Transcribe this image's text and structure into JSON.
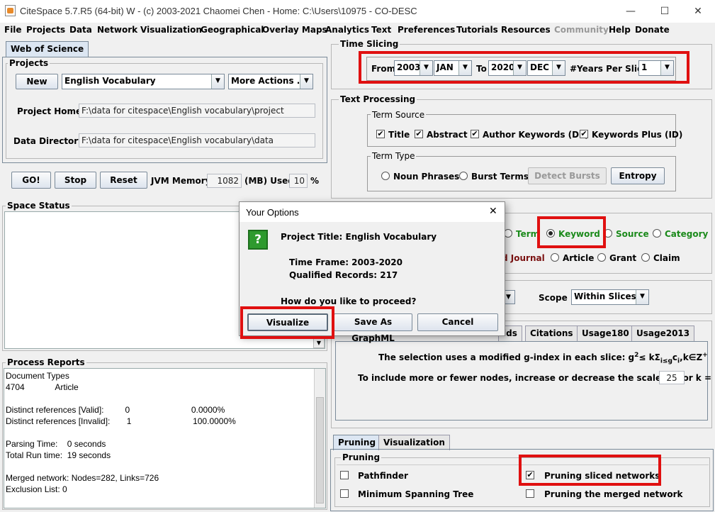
{
  "window": {
    "title": "CiteSpace 5.7.R5 (64-bit) W - (c) 2003-2021 Chaomei Chen - Home: C:\\Users\\10975 - CO-DESC",
    "minimize": "—",
    "maximize": "☐",
    "close": "✕"
  },
  "menu": [
    "File",
    "Projects",
    "Data",
    "Network",
    "Visualization",
    "Geographical",
    "Overlay Maps",
    "Analytics",
    "Text",
    "Preferences",
    "Tutorials",
    "Resources",
    "Community",
    "Help",
    "Donate"
  ],
  "left": {
    "tab": "Web of Science",
    "projects_label": "Projects",
    "new_btn": "New",
    "project_select": "English Vocabulary",
    "more_actions": "More Actions ...",
    "project_home_label": "Project Home:",
    "project_home": "F:\\data for citespace\\English vocabulary\\project",
    "data_dir_label": "Data Directory:",
    "data_dir": "F:\\data for citespace\\English vocabulary\\data",
    "go_btn": "GO!",
    "stop_btn": "Stop",
    "reset_btn": "Reset",
    "jvm_label": "JVM Memory",
    "jvm_value": "1082",
    "mb_used_label": "(MB) Used",
    "used_value": "10",
    "pct": "%",
    "space_status": "Space Status",
    "process_reports": "Process Reports",
    "report_lines": [
      "Document Types",
      "4704             Article",
      "",
      "Distinct references [Valid]:         0                          0.0000%",
      "Distinct references [Invalid]:       1                          100.0000%",
      "",
      "Parsing Time:    0 seconds",
      "Total Run time:  19 seconds",
      "",
      "Merged network: Nodes=282, Links=726",
      "Exclusion List: 0"
    ]
  },
  "time_slicing": {
    "label": "Time Slicing",
    "from": "From",
    "from_year": "2003",
    "from_month": "JAN",
    "to": "To",
    "to_year": "2020",
    "to_month": "DEC",
    "years_per_slice_label": "#Years Per Slice",
    "years_per_slice": "1"
  },
  "text_processing": {
    "label": "Text Processing",
    "term_source": "Term Source",
    "title": "Title",
    "abstract": "Abstract",
    "author_kw": "Author Keywords (DE)",
    "kw_plus": "Keywords Plus (ID)",
    "term_type": "Term Type",
    "noun_phrases": "Noun Phrases",
    "burst_terms": "Burst Terms",
    "detect_bursts": "Detect Bursts",
    "entropy": "Entropy"
  },
  "node_types": {
    "term": "Term",
    "keyword": "Keyword",
    "source": "Source",
    "category": "Category",
    "cited_journal": "d Journal",
    "article": "Article",
    "grant": "Grant",
    "claim": "Claim"
  },
  "scope": {
    "label": "Scope",
    "value": "Within Slices"
  },
  "selection_tabs": [
    "lds",
    "Citations",
    "Usage180",
    "Usage2013"
  ],
  "gindex": {
    "text_pre": "The selection uses a modified g-index in each slice: g",
    "sup": "2",
    "text_mid": "≤ kΣ",
    "sub": "i≤g",
    "c": "c",
    "ci_sub": "i",
    "tail": ",k∈Z",
    "sup2": "+",
    "scale_text": "To include more or fewer nodes, increase or decrease the scale factor k =",
    "k": "25"
  },
  "pruning": {
    "tab_pruning": "Pruning",
    "tab_vis": "Visualization",
    "label": "Pruning",
    "pathfinder": "Pathfinder",
    "mst": "Minimum Spanning Tree",
    "sliced": "Pruning sliced networks",
    "merged": "Pruning the merged network"
  },
  "dialog": {
    "title": "Your Options",
    "close": "✕",
    "q": "?",
    "project_title": "Project Title: English Vocabulary",
    "time_frame": "Time Frame: 2003-2020",
    "records": "Qualified Records: 217",
    "question": "How do you like to proceed?",
    "visualize": "Visualize",
    "graphml": "Save As GraphML",
    "cancel": "Cancel"
  },
  "accent": "#e01010"
}
